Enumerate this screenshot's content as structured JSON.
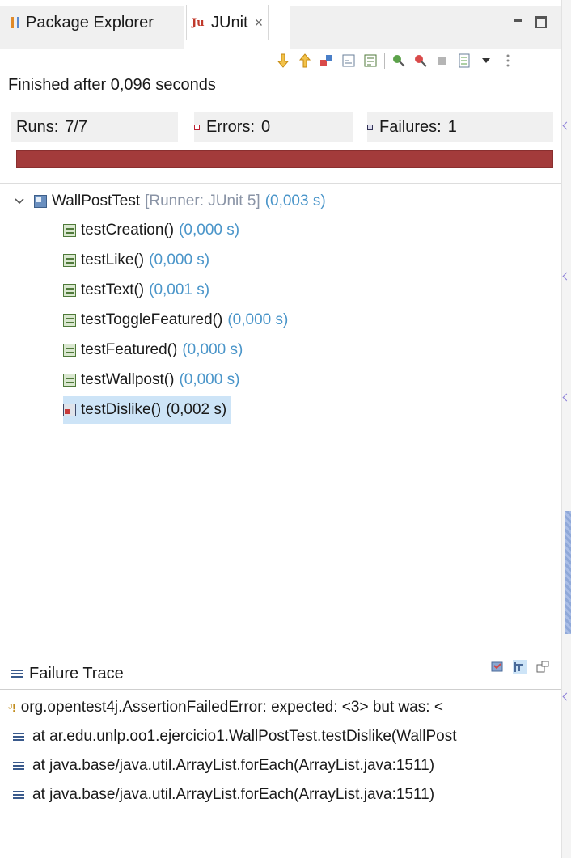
{
  "tabs": {
    "package_explorer": "Package Explorer",
    "junit": "JUnit",
    "junit_icon_text": "Ju",
    "close_glyph": "×"
  },
  "status": {
    "finished": "Finished after 0,096 seconds"
  },
  "counters": {
    "runs_label": "Runs:",
    "runs_value": "7/7",
    "errors_label": "Errors:",
    "errors_value": "0",
    "failures_label": "Failures:",
    "failures_value": "1",
    "bar_color": "#a33b3b"
  },
  "tree": {
    "suite": {
      "name": "WallPostTest",
      "runner": "[Runner: JUnit 5]",
      "time": "(0,003 s)"
    },
    "tests": [
      {
        "name": "testCreation()",
        "time": "(0,000 s)",
        "status": "passed"
      },
      {
        "name": "testLike()",
        "time": "(0,000 s)",
        "status": "passed"
      },
      {
        "name": "testText()",
        "time": "(0,001 s)",
        "status": "passed"
      },
      {
        "name": "testToggleFeatured()",
        "time": "(0,000 s)",
        "status": "passed"
      },
      {
        "name": "testFeatured()",
        "time": "(0,000 s)",
        "status": "passed"
      },
      {
        "name": "testWallpost()",
        "time": "(0,000 s)",
        "status": "passed"
      },
      {
        "name": "testDislike()",
        "time": "(0,002 s)",
        "status": "failed"
      }
    ]
  },
  "failure_trace": {
    "title": "Failure Trace",
    "lines": [
      "org.opentest4j.AssertionFailedError: expected: <3> but was: <",
      "at ar.edu.unlp.oo1.ejercicio1.WallPostTest.testDislike(WallPost",
      "at java.base/java.util.ArrayList.forEach(ArrayList.java:1511)",
      "at java.base/java.util.ArrayList.forEach(ArrayList.java:1511)"
    ]
  },
  "icons": {
    "package_explorer": "package-explorer-icon",
    "junit": "junit-icon",
    "minimize": "minimize-icon",
    "maximize": "maximize-icon",
    "toolbar": [
      "next-failure-icon",
      "previous-failure-icon",
      "show-failures-only-icon",
      "scroll-lock-icon",
      "show-skipped-icon",
      "rerun-test-icon",
      "rerun-failures-first-icon",
      "stop-icon",
      "history-icon",
      "view-menu-icon",
      "more-icon"
    ],
    "trace": [
      "filter-stack-trace-icon",
      "compare-result-icon",
      "copy-trace-icon"
    ]
  }
}
